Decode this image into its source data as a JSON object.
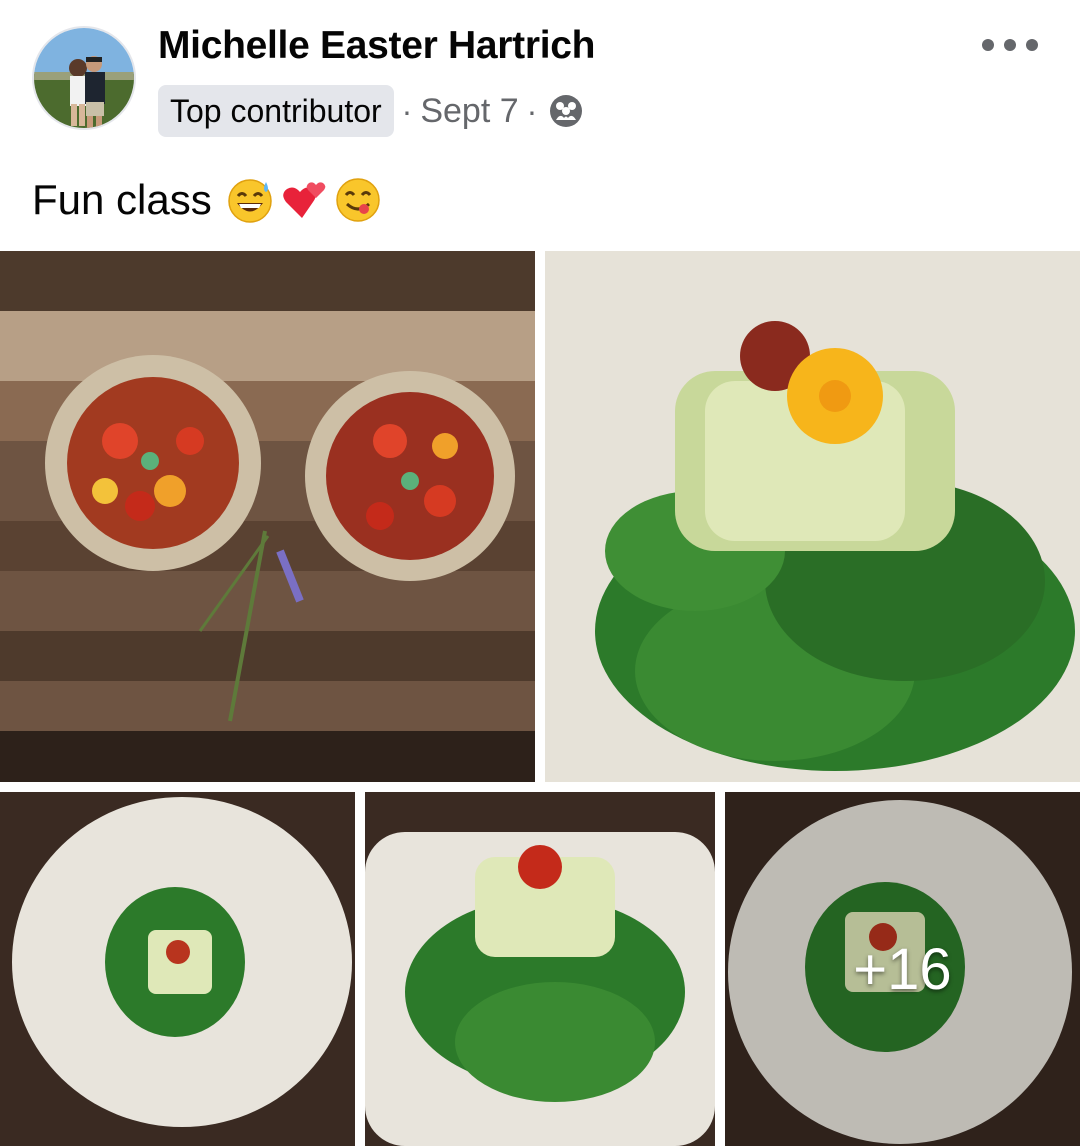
{
  "post": {
    "author": "Michelle Easter Hartrich",
    "badge": "Top contributor",
    "separator": "·",
    "date": "Sept 7",
    "audience_icon": "group-icon",
    "menu_icon": "more-options-icon",
    "caption": "Fun class",
    "caption_emojis": [
      "grinning-sweat-emoji",
      "two-hearts-emoji",
      "savoring-food-emoji"
    ]
  },
  "photos": {
    "count": 5,
    "more_label": "+16",
    "items": [
      {
        "subject": "tomato-tarts-on-wood-board"
      },
      {
        "subject": "zucchini-roll-with-flower-on-spinach"
      },
      {
        "subject": "plated-zucchini-roll-on-spinach"
      },
      {
        "subject": "zucchini-roll-on-spinach-closeup"
      },
      {
        "subject": "plated-zucchini-roll-top-view"
      }
    ]
  },
  "colors": {
    "text_primary": "#050505",
    "text_secondary": "#65676b",
    "badge_bg": "#e4e6eb",
    "wood_dark": "#5a4636",
    "plate": "#e8e4dc",
    "spinach": "#2f7a2a",
    "tomato": "#d63a22",
    "flower": "#f7b51b"
  }
}
